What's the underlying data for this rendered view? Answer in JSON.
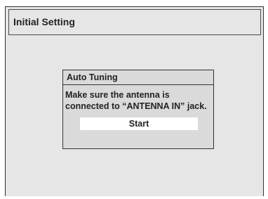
{
  "screen": {
    "title": "Initial Setting"
  },
  "dialog": {
    "title": "Auto Tuning",
    "message_lines": [
      "Make sure the antenna is",
      "connected to “ANTENNA IN” jack."
    ],
    "start_label": "Start"
  },
  "colors": {
    "background": "#e6e6e6",
    "dialog_background": "#dadada",
    "button_background": "#ffffff",
    "border": "#333333",
    "text": "#222222"
  }
}
